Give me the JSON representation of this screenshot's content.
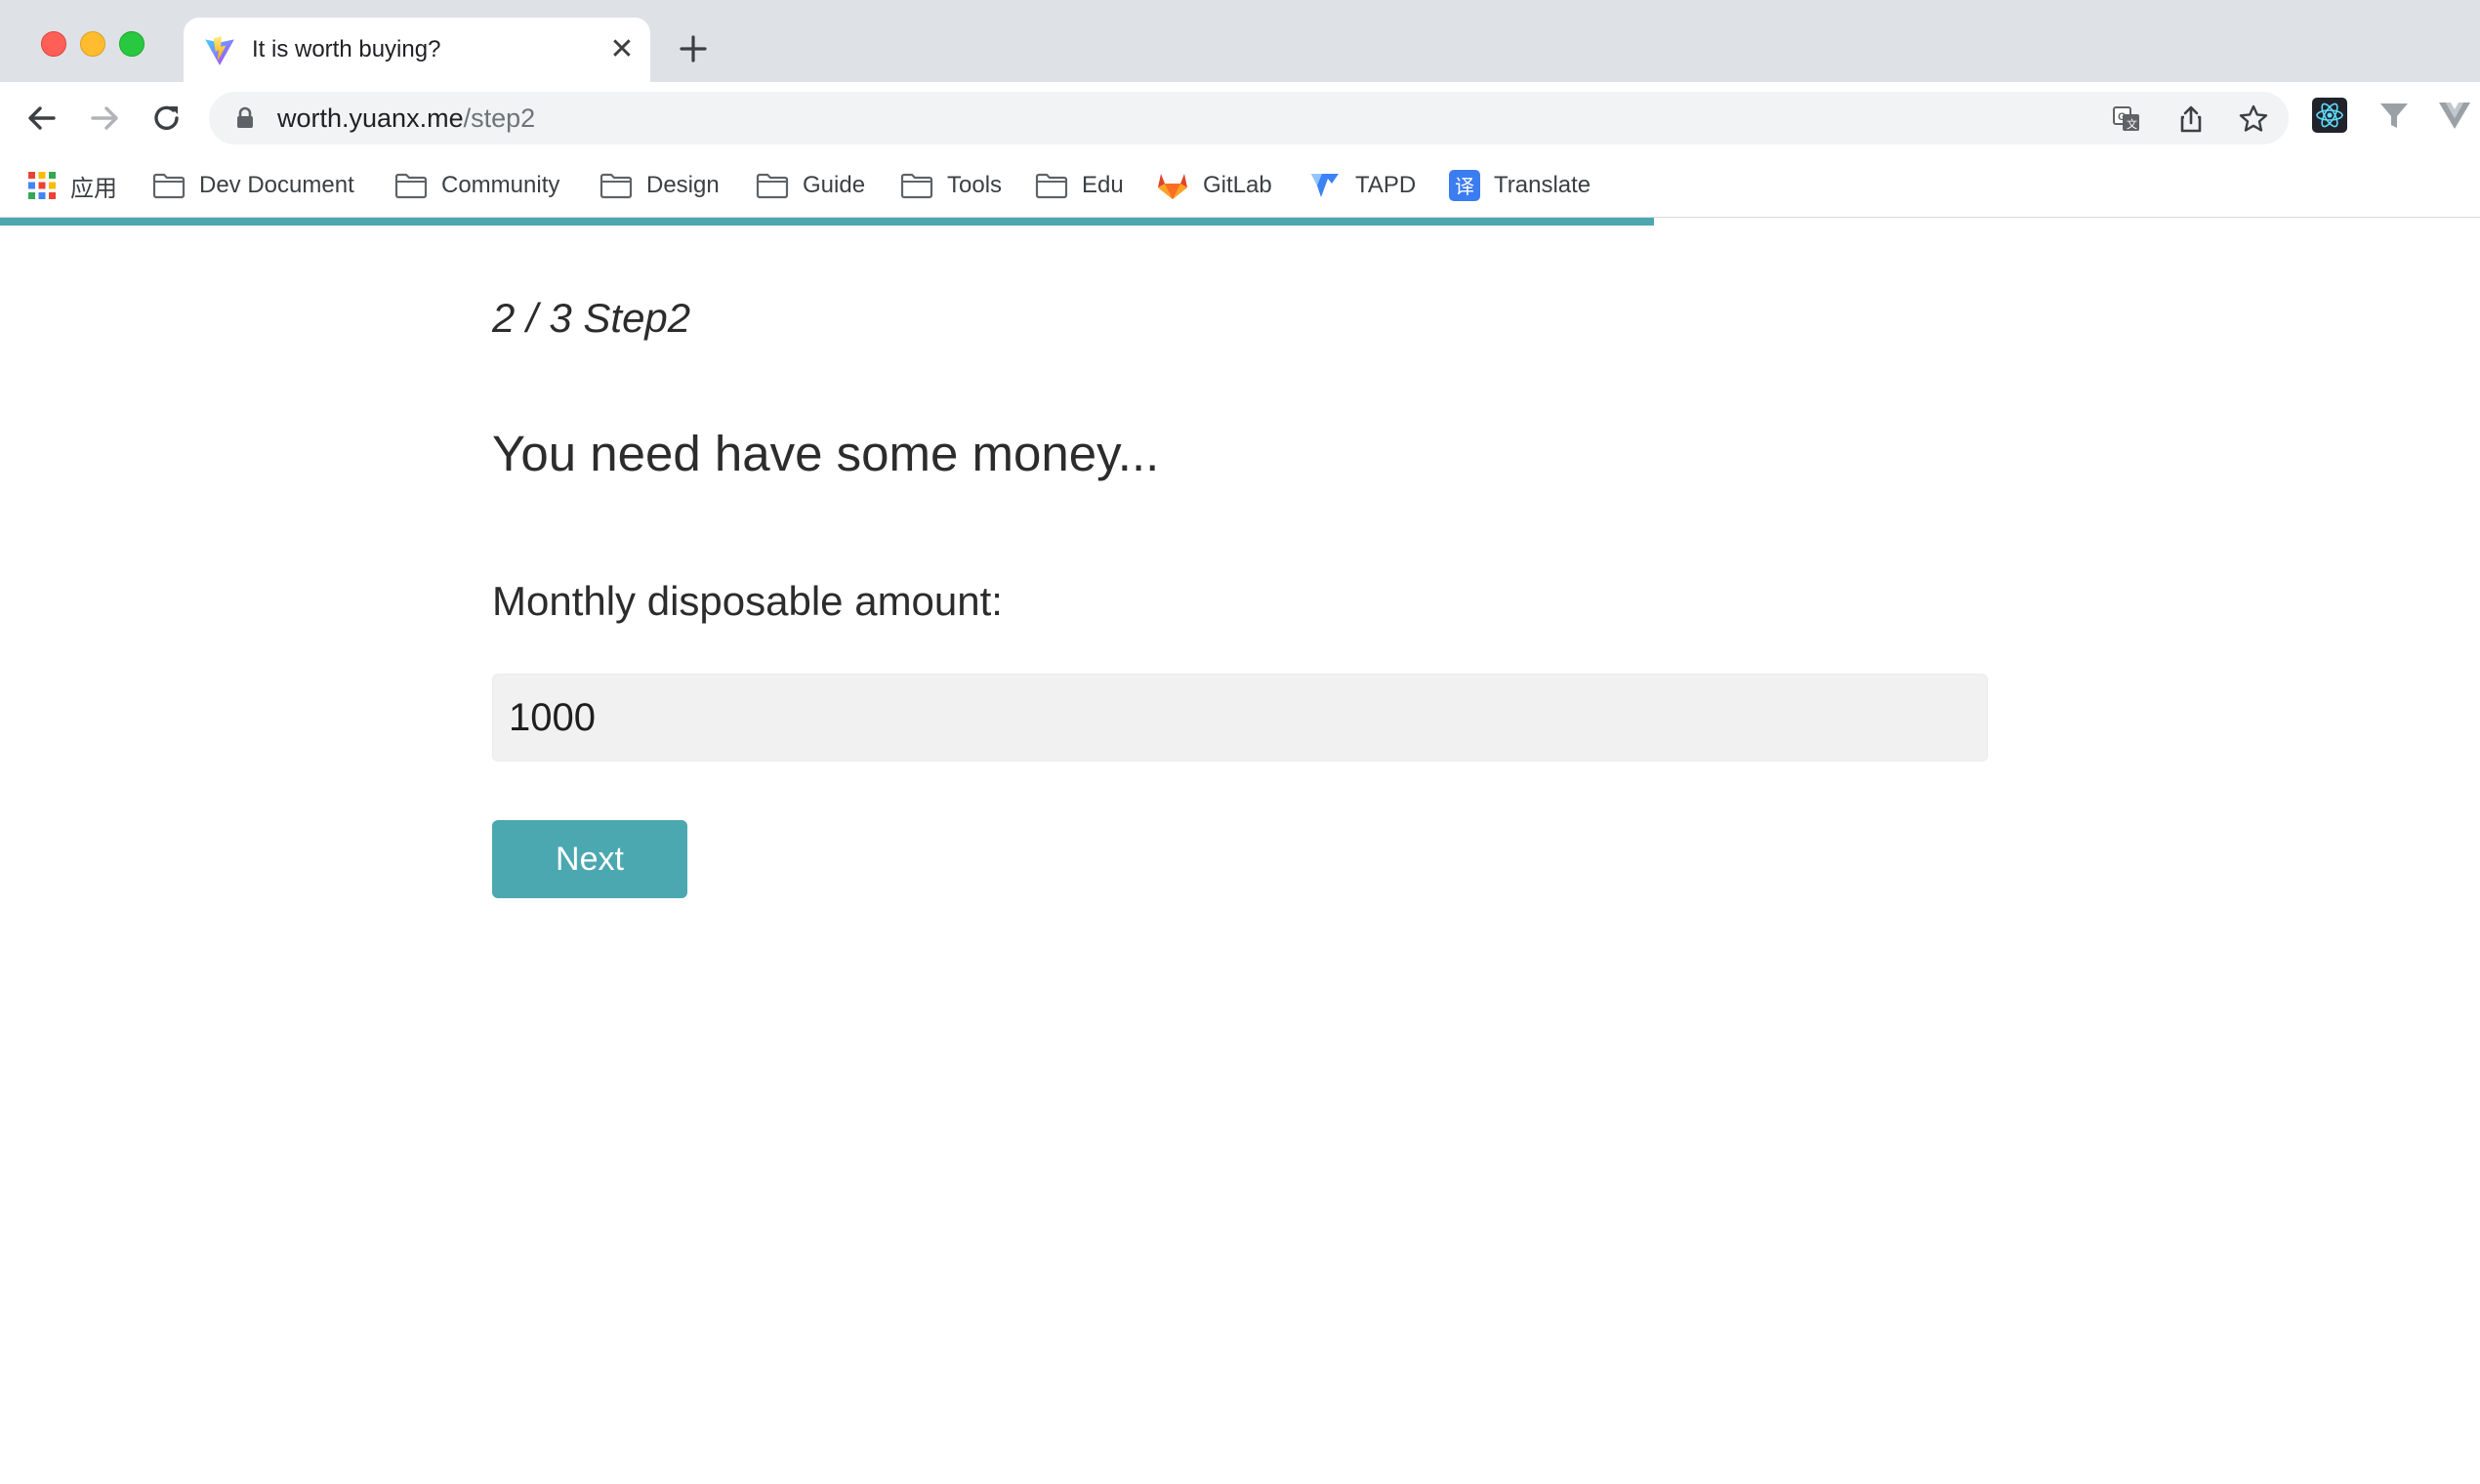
{
  "browser": {
    "tab": {
      "title": "It is worth buying?",
      "close_glyph": "✕"
    },
    "address": {
      "host": "worth.yuanx.me",
      "path": "/step2"
    },
    "bookmarks": [
      {
        "label": "应用",
        "icon": "apps-grid-icon"
      },
      {
        "label": "Dev Document",
        "icon": "folder-icon"
      },
      {
        "label": "Community",
        "icon": "folder-icon"
      },
      {
        "label": "Design",
        "icon": "folder-icon"
      },
      {
        "label": "Guide",
        "icon": "folder-icon"
      },
      {
        "label": "Tools",
        "icon": "folder-icon"
      },
      {
        "label": "Edu",
        "icon": "folder-icon"
      },
      {
        "label": "GitLab",
        "icon": "gitlab-icon"
      },
      {
        "label": "TAPD",
        "icon": "tapd-icon"
      },
      {
        "label": "Translate",
        "icon": "translate-icon"
      }
    ],
    "extensions": [
      "react-devtools-icon",
      "filter-icon",
      "vue-icon"
    ],
    "colors": {
      "tabstrip": "#dee1e6",
      "omnibox": "#f1f3f4"
    }
  },
  "page": {
    "progress": 0.667,
    "step_text": "2 / 3 Step2",
    "question": "You need have some money...",
    "field_label": "Monthly disposable amount:",
    "amount_value": "1000",
    "next_label": "Next",
    "accent_color": "#4ba8b0"
  }
}
